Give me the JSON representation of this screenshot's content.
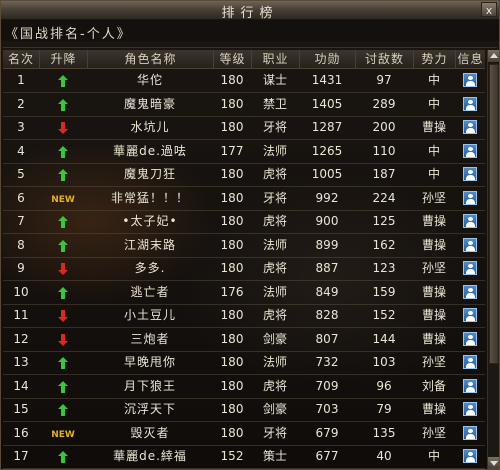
{
  "window": {
    "title": "排行榜",
    "close_label": "x"
  },
  "subtitle": "《国战排名-个人》",
  "columns": [
    "名次",
    "升降",
    "角色名称",
    "等级",
    "职业",
    "功勋",
    "讨敌数",
    "势力",
    "信息"
  ],
  "colors": {
    "up": "#3cc43c",
    "down": "#d82a20",
    "new": "#e2b020"
  },
  "rows": [
    {
      "rank": "1",
      "change": "up",
      "name": "华佗",
      "level": "180",
      "job": "谋士",
      "merit": "1431",
      "kills": "97",
      "faction": "中"
    },
    {
      "rank": "2",
      "change": "up",
      "name": "魔鬼暗豪",
      "level": "180",
      "job": "禁卫",
      "merit": "1405",
      "kills": "289",
      "faction": "中"
    },
    {
      "rank": "3",
      "change": "down",
      "name": "水坑儿",
      "level": "180",
      "job": "牙将",
      "merit": "1287",
      "kills": "200",
      "faction": "曹操"
    },
    {
      "rank": "4",
      "change": "up",
      "name": "華麗de.過呿",
      "level": "177",
      "job": "法师",
      "merit": "1265",
      "kills": "110",
      "faction": "中"
    },
    {
      "rank": "5",
      "change": "up",
      "name": "魔鬼刀狂",
      "level": "180",
      "job": "虎将",
      "merit": "1005",
      "kills": "187",
      "faction": "中"
    },
    {
      "rank": "6",
      "change": "new",
      "change_label": "NEW",
      "name": "非常猛！！！",
      "level": "180",
      "job": "牙将",
      "merit": "992",
      "kills": "224",
      "faction": "孙坚"
    },
    {
      "rank": "7",
      "change": "up",
      "name": "•太子妃•",
      "level": "180",
      "job": "虎将",
      "merit": "900",
      "kills": "125",
      "faction": "曹操"
    },
    {
      "rank": "8",
      "change": "up",
      "name": "江湖末路",
      "level": "180",
      "job": "法师",
      "merit": "899",
      "kills": "162",
      "faction": "曹操"
    },
    {
      "rank": "9",
      "change": "down",
      "name": "多多.",
      "level": "180",
      "job": "虎将",
      "merit": "887",
      "kills": "123",
      "faction": "孙坚"
    },
    {
      "rank": "10",
      "change": "up",
      "name": "逃亡者",
      "level": "176",
      "job": "法师",
      "merit": "849",
      "kills": "159",
      "faction": "曹操"
    },
    {
      "rank": "11",
      "change": "down",
      "name": "小土豆儿",
      "level": "180",
      "job": "虎将",
      "merit": "828",
      "kills": "152",
      "faction": "曹操"
    },
    {
      "rank": "12",
      "change": "down",
      "name": "三炮者",
      "level": "180",
      "job": "剑豪",
      "merit": "807",
      "kills": "144",
      "faction": "曹操"
    },
    {
      "rank": "13",
      "change": "up",
      "name": "早晚甩你",
      "level": "180",
      "job": "法师",
      "merit": "732",
      "kills": "103",
      "faction": "孙坚"
    },
    {
      "rank": "14",
      "change": "up",
      "name": "月下狼王",
      "level": "180",
      "job": "虎将",
      "merit": "709",
      "kills": "96",
      "faction": "刘备"
    },
    {
      "rank": "15",
      "change": "up",
      "name": "沉浮天下",
      "level": "180",
      "job": "剑豪",
      "merit": "703",
      "kills": "79",
      "faction": "曹操"
    },
    {
      "rank": "16",
      "change": "new",
      "change_label": "NEW",
      "name": "毁灭者",
      "level": "180",
      "job": "牙将",
      "merit": "679",
      "kills": "135",
      "faction": "孙坚"
    },
    {
      "rank": "17",
      "change": "up",
      "name": "華麗de.緈福",
      "level": "152",
      "job": "策士",
      "merit": "677",
      "kills": "40",
      "faction": "中"
    }
  ]
}
